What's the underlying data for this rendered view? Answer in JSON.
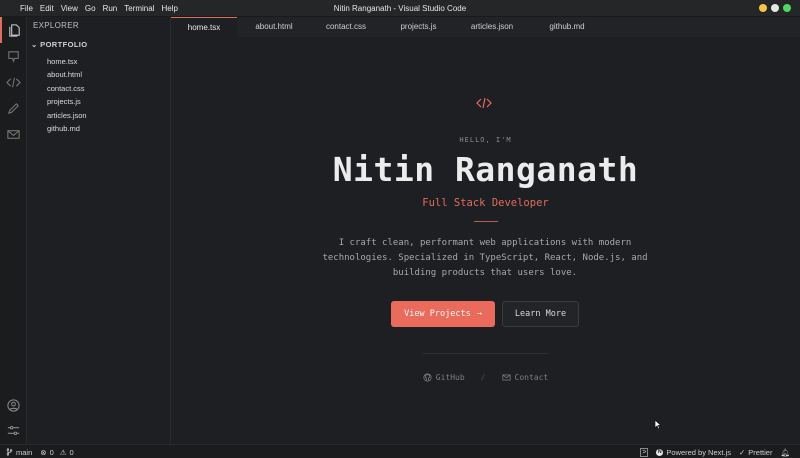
{
  "titlebar": {
    "menu": [
      "File",
      "Edit",
      "View",
      "Go",
      "Run",
      "Terminal",
      "Help"
    ],
    "title": "Nitin Ranganath - Visual Studio Code",
    "dots": [
      "#f5c542",
      "#e6e6e6",
      "#4cd964"
    ]
  },
  "activity": {
    "icons": [
      "files-icon",
      "github-icon",
      "code-icon",
      "pencil-icon",
      "mail-icon",
      "account-icon",
      "settings-sliders-icon"
    ]
  },
  "sidebar": {
    "title": "EXPLORER",
    "folder": "PORTFOLIO",
    "files": [
      "home.tsx",
      "about.html",
      "contact.css",
      "projects.js",
      "articles.json",
      "github.md"
    ]
  },
  "tabs": [
    "home.tsx",
    "about.html",
    "contact.css",
    "projects.js",
    "articles.json",
    "github.md"
  ],
  "hero": {
    "greeting": "HELLO, I'M",
    "name": "Nitin Ranganath",
    "role": "Full Stack Developer",
    "description": "I craft clean, performant web applications with modern technologies. Specialized in TypeScript, React, Node.js, and building products that users love.",
    "primary_button": "View Projects",
    "primary_arrow": "→",
    "secondary_button": "Learn More",
    "link_github": "GitHub",
    "separator": "/",
    "link_contact": "Contact"
  },
  "colors": {
    "accent": "#ea6a5c",
    "background": "#1e1f22"
  },
  "statusbar": {
    "branch": "main",
    "errors": "0",
    "warnings": "0",
    "powered": "Powered by Next.js",
    "prettier": "Prettier"
  }
}
